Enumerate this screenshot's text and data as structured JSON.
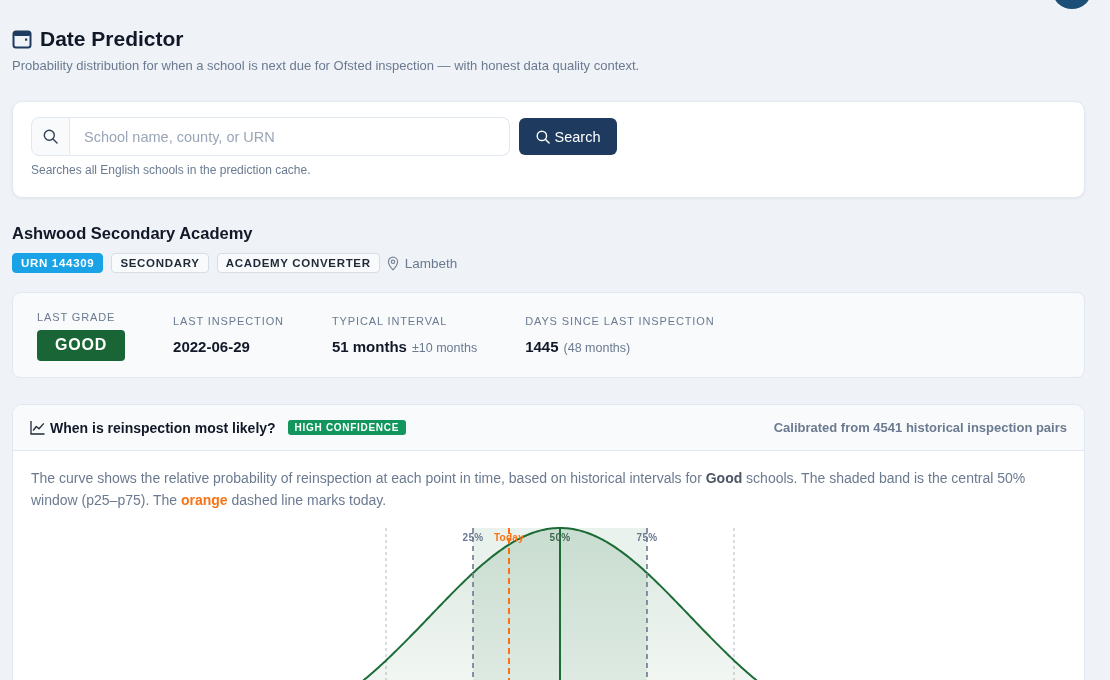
{
  "header": {
    "title": "Date Predictor",
    "subtitle": "Probability distribution for when a school is next due for Ofsted inspection — with honest data quality context."
  },
  "search": {
    "placeholder": "School name, county, or URN",
    "button": "Search",
    "hint": "Searches all English schools in the prediction cache."
  },
  "school": {
    "name": "Ashwood Secondary Academy",
    "tags": [
      {
        "text": "URN 144309",
        "kind": "id"
      },
      {
        "text": "SECONDARY",
        "kind": "tag"
      },
      {
        "text": "ACADEMY CONVERTER",
        "kind": "tag"
      }
    ],
    "location": "Lambeth"
  },
  "stats": [
    {
      "label": "LAST GRADE",
      "value": "GOOD",
      "kind": "grade"
    },
    {
      "label": "LAST INSPECTION",
      "value": "2022-06-29",
      "kind": "value"
    },
    {
      "label": "TYPICAL INTERVAL",
      "value": "51 months",
      "note": "±10 months",
      "kind": "value"
    },
    {
      "label": "DAYS SINCE LAST INSPECTION",
      "value": "1445",
      "note": "(48 months)",
      "kind": "value"
    }
  ],
  "prediction": {
    "title": "When is reinspection most likely?",
    "confidence": "HIGH CONFIDENCE",
    "calibration": "Calibrated from 4541 historical inspection pairs",
    "description": [
      {
        "text": "The curve shows the relative probability of reinspection at each point in time, based on historical intervals for ",
        "kind": "plain"
      },
      {
        "text": "Good",
        "kind": "strong"
      },
      {
        "text": " schools. The shaded band is the central 50% window (p25–p75). The ",
        "kind": "plain"
      },
      {
        "text": "orange",
        "kind": "highlight"
      },
      {
        "text": " dashed line marks today.",
        "kind": "plain"
      }
    ],
    "markers": [
      {
        "label": "25%",
        "kind": "quartile"
      },
      {
        "label": "Today",
        "kind": "today"
      },
      {
        "label": "50%",
        "kind": "median"
      },
      {
        "label": "75%",
        "kind": "quartile"
      }
    ]
  }
}
